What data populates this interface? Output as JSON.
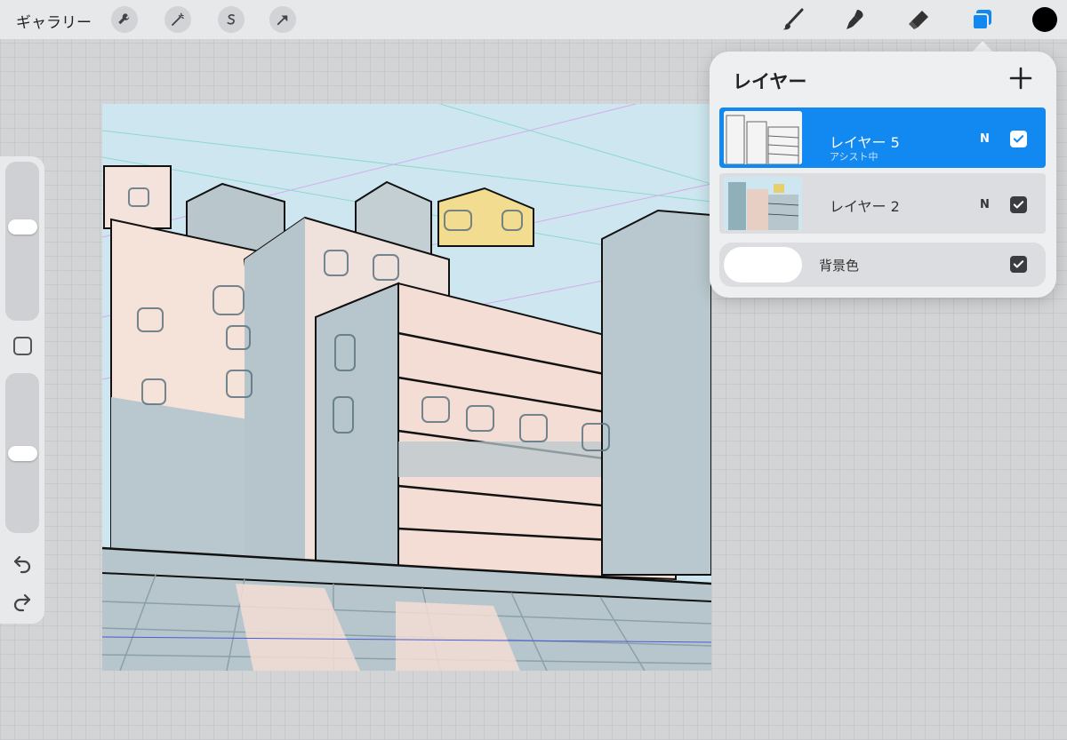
{
  "topbar": {
    "gallery_label": "ギャラリー",
    "actions": [
      "wrench-icon",
      "magic-wand-icon",
      "selection-icon",
      "transform-arrow-icon"
    ],
    "tools": [
      "brush-icon",
      "smudge-icon",
      "eraser-icon",
      "layers-icon"
    ],
    "current_color": "#000000",
    "active_tool_color": "#1288f1"
  },
  "sidebar": {
    "brush_size_level": 0.6,
    "opacity_level": 0.5
  },
  "layers_panel": {
    "title": "レイヤー",
    "layers": [
      {
        "name": "レイヤー 5",
        "subtitle": "アシスト中",
        "blend": "N",
        "visible": true,
        "selected": true
      },
      {
        "name": "レイヤー 2",
        "blend": "N",
        "visible": true,
        "selected": false
      }
    ],
    "background": {
      "name": "背景色",
      "color": "#ffffff",
      "visible": true
    }
  }
}
